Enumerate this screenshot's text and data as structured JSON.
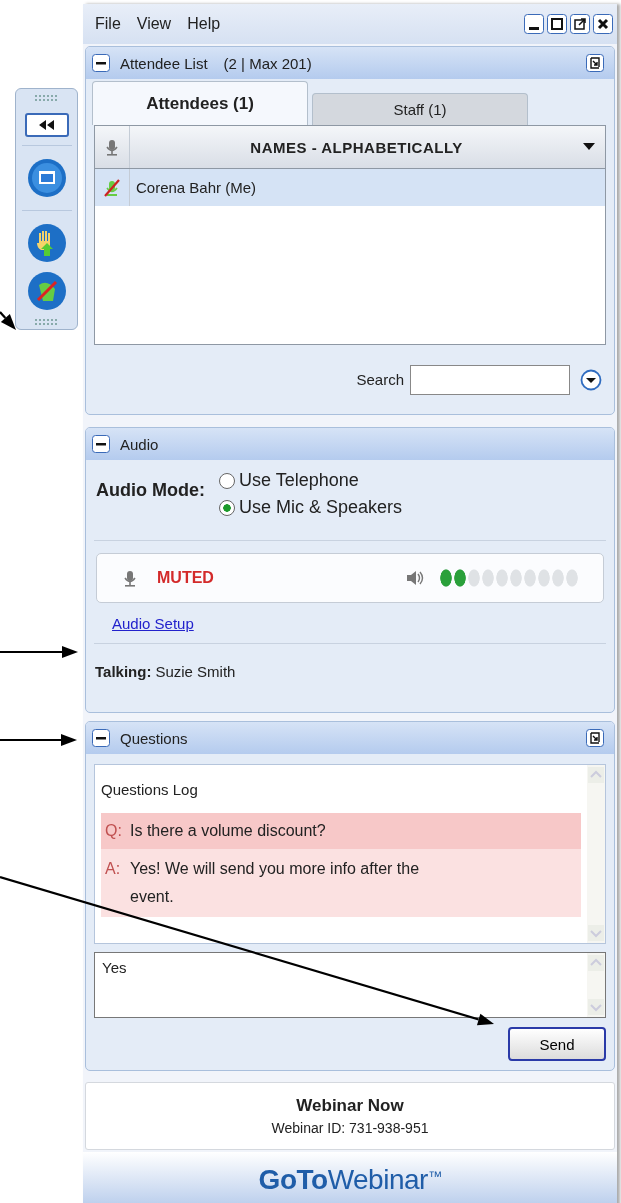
{
  "menu": [
    "File",
    "View",
    "Help"
  ],
  "attendee_panel": {
    "title": "Attendee List",
    "count": "(2 | Max 201)",
    "tabs": [
      {
        "label": "Attendees (1)",
        "selected": true
      },
      {
        "label": "Staff (1)",
        "selected": false
      }
    ],
    "column_header": "NAMES - ALPHABETICALLY",
    "rows": [
      {
        "name": "Corena Bahr (Me)",
        "selected": true,
        "muted": true
      }
    ],
    "search": {
      "label": "Search"
    }
  },
  "audio_panel": {
    "title": "Audio",
    "mode_label": "Audio Mode:",
    "options": [
      {
        "label": "Use Telephone",
        "selected": false
      },
      {
        "label": "Use Mic & Speakers",
        "selected": true
      }
    ],
    "mic_status": "MUTED",
    "speaker_meter": {
      "level": 0.2
    },
    "setup_link": "Audio Setup",
    "talking": "**Talking:** Suzie Smith"
  },
  "questions_panel": {
    "title": "Questions",
    "log_title": "Questions Log",
    "entries": [
      {
        "kind": "question",
        "prefix": "Q:",
        "text": "Is there a volume discount?"
      },
      {
        "kind": "answer",
        "prefix": "A:",
        "text": "Yes! We will send you more info after the event."
      }
    ],
    "input": {
      "value": "Yes"
    },
    "send_button": "Send"
  },
  "footer": {
    "webinar_name": "Webinar Now",
    "webinar_id": "Webinar ID: 731-938-951"
  },
  "logo": {
    "bold": "GoTo",
    "regular": "Webinar",
    "mark": "™"
  }
}
